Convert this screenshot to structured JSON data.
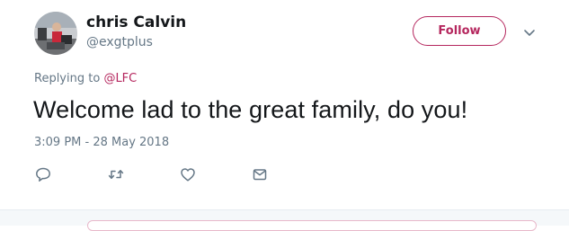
{
  "user": {
    "name": "chris Calvin",
    "handle": "@exgtplus"
  },
  "follow": {
    "label": "Follow"
  },
  "reply": {
    "prefix": "Replying to",
    "mention": "@LFC"
  },
  "tweet": {
    "text": "Welcome lad to the great family, do you!",
    "timestamp": "3:09 PM - 28 May 2018"
  },
  "actions": [
    "reply-icon",
    "retweet-icon",
    "like-icon",
    "direct-message-icon"
  ],
  "colors": {
    "accent": "#b5275e",
    "text_primary": "#14171a",
    "text_secondary": "#657786",
    "divider": "#e6ecf0"
  }
}
